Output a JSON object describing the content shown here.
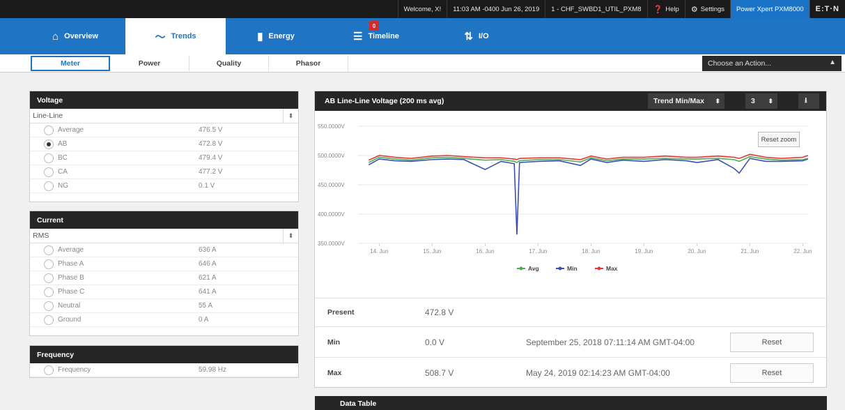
{
  "topbar": {
    "welcome": "Welcome, X!",
    "datetime": "11:03 AM -0400 Jun 26, 2019",
    "meter_name": "1 - CHF_SWBD1_UTIL_PXM8",
    "help": "Help",
    "settings": "Settings",
    "device": "Power Xpert PXM8000",
    "brand": "E:T·N"
  },
  "nav": {
    "tabs": [
      {
        "label": "Overview",
        "icon": "home-icon"
      },
      {
        "label": "Trends",
        "icon": "trend-icon"
      },
      {
        "label": "Energy",
        "icon": "bar-chart-icon"
      },
      {
        "label": "Timeline",
        "icon": "list-icon"
      },
      {
        "label": "I/O",
        "icon": "up-down-arrows-icon"
      }
    ],
    "timeline_badge": "0",
    "active_tab": "Trends"
  },
  "subnav": {
    "tabs": [
      "Meter",
      "Power",
      "Quality",
      "Phasor"
    ],
    "active": "Meter",
    "action_placeholder": "Choose an Action..."
  },
  "voltage": {
    "title": "Voltage",
    "selector": "Line-Line",
    "rows": [
      {
        "label": "Average",
        "value": "476.5 V",
        "selected": false
      },
      {
        "label": "AB",
        "value": "472.8 V",
        "selected": true
      },
      {
        "label": "BC",
        "value": "479.4 V",
        "selected": false
      },
      {
        "label": "CA",
        "value": "477.2 V",
        "selected": false
      },
      {
        "label": "NG",
        "value": "0.1 V",
        "selected": false
      }
    ]
  },
  "current": {
    "title": "Current",
    "selector": "RMS",
    "rows": [
      {
        "label": "Average",
        "value": "636 A"
      },
      {
        "label": "Phase A",
        "value": "646 A"
      },
      {
        "label": "Phase B",
        "value": "621 A"
      },
      {
        "label": "Phase C",
        "value": "641 A"
      },
      {
        "label": "Neutral",
        "value": "55 A"
      },
      {
        "label": "Ground",
        "value": "0 A"
      }
    ]
  },
  "frequency": {
    "title": "Frequency",
    "rows": [
      {
        "label": "Frequency",
        "value": "59.98 Hz"
      }
    ]
  },
  "chart_panel": {
    "title": "AB Line-Line Voltage (200 ms avg)",
    "trend_select": "Trend Min/Max",
    "count_select": "3",
    "reset_zoom": "Reset zoom"
  },
  "stats": {
    "present_label": "Present",
    "present_value": "472.8 V",
    "min_label": "Min",
    "min_value": "0.0 V",
    "min_time": "September 25, 2018 07:11:14 AM GMT-04:00",
    "max_label": "Max",
    "max_value": "508.7 V",
    "max_time": "May 24, 2019 02:14:23 AM GMT-04:00",
    "reset_label": "Reset"
  },
  "data_table": {
    "title": "Data Table"
  },
  "colors": {
    "accent": "#1f74c4",
    "avg": "#4caf50",
    "min": "#3a4fb5",
    "max": "#e53935",
    "header": "#262626"
  },
  "chart_data": {
    "type": "line",
    "x": [
      "13.8 Jun",
      "14.0 Jun",
      "14.3 Jun",
      "14.6 Jun",
      "15.0 Jun",
      "15.3 Jun",
      "15.6 Jun",
      "16.0 Jun",
      "16.3 Jun",
      "16.55 Jun",
      "16.6 Jun",
      "16.65 Jun",
      "17.0 Jun",
      "17.4 Jun",
      "17.8 Jun",
      "18.0 Jun",
      "18.3 Jun",
      "18.6 Jun",
      "19.0 Jun",
      "19.4 Jun",
      "19.8 Jun",
      "20.0 Jun",
      "20.4 Jun",
      "20.7 Jun",
      "20.8 Jun",
      "21.0 Jun",
      "21.3 Jun",
      "21.6 Jun",
      "22.0 Jun",
      "22.1 Jun"
    ],
    "series": [
      {
        "name": "Avg",
        "values": [
          488,
          497,
          494,
          492,
          496,
          497,
          495,
          492,
          493,
          490,
          488,
          491,
          493,
          493,
          489,
          496,
          491,
          494,
          494,
          495,
          494,
          494,
          495,
          493,
          490,
          498,
          494,
          492,
          493,
          495
        ]
      },
      {
        "name": "Min",
        "values": [
          484,
          494,
          491,
          490,
          493,
          494,
          493,
          476,
          490,
          486,
          365,
          488,
          490,
          491,
          483,
          494,
          488,
          492,
          490,
          493,
          491,
          488,
          493,
          478,
          470,
          495,
          490,
          490,
          491,
          494
        ]
      },
      {
        "name": "Max",
        "values": [
          492,
          500,
          497,
          495,
          499,
          500,
          498,
          496,
          496,
          494,
          493,
          495,
          496,
          496,
          493,
          499,
          494,
          497,
          497,
          499,
          497,
          497,
          499,
          497,
          495,
          502,
          497,
          495,
          497,
          500
        ]
      }
    ],
    "xticks": [
      "14. Jun",
      "15. Jun",
      "16. Jun",
      "17. Jun",
      "18. Jun",
      "19. Jun",
      "20. Jun",
      "21. Jun",
      "22. Jun"
    ],
    "yticks": [
      "550.0000V",
      "500.0000V",
      "450.0000V",
      "400.0000V",
      "350.0000V"
    ],
    "ylim": [
      350,
      550
    ],
    "xlim": [
      13.6,
      22.1
    ],
    "legend": "bottom-center",
    "grid": true
  }
}
